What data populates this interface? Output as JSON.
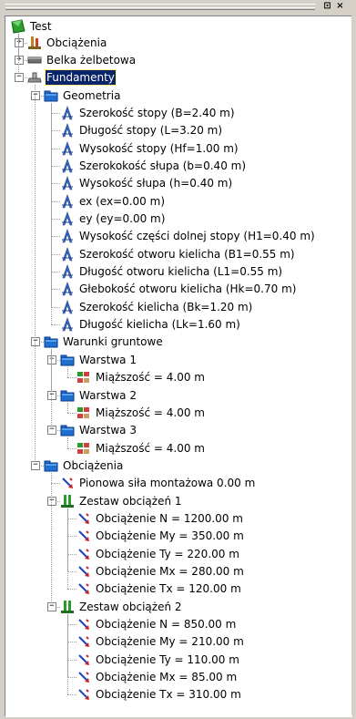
{
  "window": {
    "pin_label": "⊡",
    "close_label": "×"
  },
  "tree": {
    "root": "Test",
    "items": [
      {
        "label": "Obciążenia",
        "icon": "loads-icon"
      },
      {
        "label": "Belka żelbetowa",
        "icon": "beam-icon"
      },
      {
        "label": "Fundamenty",
        "icon": "foundation-icon",
        "selected": true
      },
      {
        "label": "Geometria",
        "icon": "folder-icon"
      },
      {
        "label": "Szerokość stopy (B=2.40 m)",
        "icon": "dimension-icon"
      },
      {
        "label": "Długość stopy (L=3.20 m)",
        "icon": "dimension-icon"
      },
      {
        "label": "Wysokość stopy (Hf=1.00 m)",
        "icon": "dimension-icon"
      },
      {
        "label": "Szerokokość słupa (b=0.40 m)",
        "icon": "dimension-icon"
      },
      {
        "label": "Wysokość słupa (h=0.40 m)",
        "icon": "dimension-icon"
      },
      {
        "label": "ex (ex=0.00 m)",
        "icon": "dimension-icon"
      },
      {
        "label": "ey (ey=0.00 m)",
        "icon": "dimension-icon"
      },
      {
        "label": "Wysokość części dolnej stopy (H1=0.40 m)",
        "icon": "dimension-icon"
      },
      {
        "label": "Szerokość otworu kielicha (B1=0.55 m)",
        "icon": "dimension-icon"
      },
      {
        "label": "Długość otworu kielicha (L1=0.55 m)",
        "icon": "dimension-icon"
      },
      {
        "label": "Głebokość otworu kielicha (Hk=0.70 m)",
        "icon": "dimension-icon"
      },
      {
        "label": "Szerokość kielicha (Bk=1.20 m)",
        "icon": "dimension-icon"
      },
      {
        "label": "Długość kielicha (Lk=1.60 m)",
        "icon": "dimension-icon"
      },
      {
        "label": "Warunki gruntowe",
        "icon": "folder-icon"
      },
      {
        "label": "Warstwa 1",
        "icon": "folder-icon"
      },
      {
        "label": "Miąższość = 4.00 m",
        "icon": "soil-layer-icon"
      },
      {
        "label": "Warstwa 2",
        "icon": "folder-icon"
      },
      {
        "label": "Miąższość = 4.00 m",
        "icon": "soil-layer-icon"
      },
      {
        "label": "Warstwa 3",
        "icon": "folder-icon"
      },
      {
        "label": "Miąższość = 4.00 m",
        "icon": "soil-layer-icon"
      },
      {
        "label": "Obciążenia",
        "icon": "folder-icon"
      },
      {
        "label": "Pionowa siła montażowa 0.00 m",
        "icon": "force-icon"
      },
      {
        "label": "Zestaw obciążeń 1",
        "icon": "load-set-icon"
      },
      {
        "label": "Obciążenie N = 1200.00 m",
        "icon": "force-icon"
      },
      {
        "label": "Obciążenie My = 350.00 m",
        "icon": "force-icon"
      },
      {
        "label": "Obciążenie Ty = 220.00 m",
        "icon": "force-icon"
      },
      {
        "label": "Obciążenie Mx = 280.00 m",
        "icon": "force-icon"
      },
      {
        "label": "Obciążenie Tx = 120.00 m",
        "icon": "force-icon"
      },
      {
        "label": "Zestaw obciążeń 2",
        "icon": "load-set-icon"
      },
      {
        "label": "Obciążenie N = 850.00 m",
        "icon": "force-icon"
      },
      {
        "label": "Obciążenie My = 210.00 m",
        "icon": "force-icon"
      },
      {
        "label": "Obciążenie Ty = 110.00 m",
        "icon": "force-icon"
      },
      {
        "label": "Obciążenie Mx = 85.00 m",
        "icon": "force-icon"
      },
      {
        "label": "Obciążenie Tx = 310.00 m",
        "icon": "force-icon"
      }
    ]
  }
}
